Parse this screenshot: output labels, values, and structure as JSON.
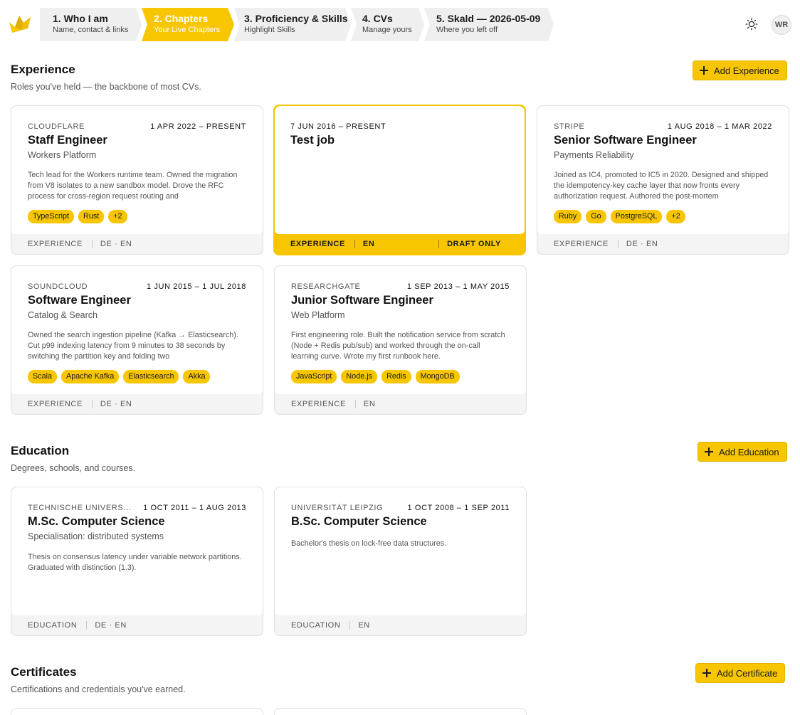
{
  "nav": {
    "steps": [
      {
        "title": "1. Who I am",
        "subtitle": "Name, contact & links"
      },
      {
        "title": "2. Chapters",
        "subtitle": "Your Live Chapters"
      },
      {
        "title": "3. Proficiency & Skills",
        "subtitle": "Highlight Skills"
      },
      {
        "title": "4. CVs",
        "subtitle": "Manage yours"
      },
      {
        "title": "5. Skald — 2026-05-09",
        "subtitle": "Where you left off"
      }
    ],
    "active_step": 1,
    "avatar_initials": "WR",
    "theme_icon": "sun-icon",
    "logo_icon": "bird-logo-icon",
    "accent_color": "#f7c600"
  },
  "experience": {
    "title": "Experience",
    "subtitle": "Roles you've held — the backbone of most CVs.",
    "add_label": "Add Experience",
    "cards": [
      {
        "org": "CLOUDFLARE",
        "dates": "1 APR 2022 – PRESENT",
        "title": "Staff Engineer",
        "subtitle": "Workers Platform",
        "description": "Tech lead for the Workers runtime team. Owned the migration from V8 isolates to a new sandbox model. Drove the RFC process for cross-region request routing and",
        "tags": [
          "TypeScript",
          "Rust",
          "+2"
        ],
        "kind": "EXPERIENCE",
        "langs": "DE · EN"
      },
      {
        "org": "",
        "dates": "7 JUN 2016 – PRESENT",
        "title": "Test job",
        "subtitle": "",
        "description": "",
        "tags": [],
        "kind": "EXPERIENCE",
        "langs": "EN",
        "status": "DRAFT ONLY"
      },
      {
        "org": "STRIPE",
        "dates": "1 AUG 2018 – 1 MAR 2022",
        "title": "Senior Software Engineer",
        "subtitle": "Payments Reliability",
        "description": "Joined as IC4, promoted to IC5 in 2020. Designed and shipped the idempotency-key cache layer that now fronts every authorization request. Authored the post-mortem",
        "tags": [
          "Ruby",
          "Go",
          "PostgreSQL",
          "+2"
        ],
        "kind": "EXPERIENCE",
        "langs": "DE · EN"
      },
      {
        "org": "SOUNDCLOUD",
        "dates": "1 JUN 2015 – 1 JUL 2018",
        "title": "Software Engineer",
        "subtitle": "Catalog & Search",
        "description": "Owned the search ingestion pipeline (Kafka → Elasticsearch). Cut p99 indexing latency from 9 minutes to 38 seconds by switching the partition key and folding two",
        "tags": [
          "Scala",
          "Apache Kafka",
          "Elasticsearch",
          "Akka"
        ],
        "kind": "EXPERIENCE",
        "langs": "DE · EN"
      },
      {
        "org": "RESEARCHGATE",
        "dates": "1 SEP 2013 – 1 MAY 2015",
        "title": "Junior Software Engineer",
        "subtitle": "Web Platform",
        "description": "First engineering role. Built the notification service from scratch (Node + Redis pub/sub) and worked through the on-call learning curve. Wrote my first runbook here.",
        "tags": [
          "JavaScript",
          "Node.js",
          "Redis",
          "MongoDB"
        ],
        "kind": "EXPERIENCE",
        "langs": "EN"
      }
    ]
  },
  "education": {
    "title": "Education",
    "subtitle": "Degrees, schools, and courses.",
    "add_label": "Add Education",
    "cards": [
      {
        "org": "TECHNISCHE UNIVERSIT...",
        "dates": "1 OCT 2011 – 1 AUG 2013",
        "title": "M.Sc. Computer Science",
        "subtitle": "Specialisation: distributed systems",
        "description": "Thesis on consensus latency under variable network partitions. Graduated with distinction (1.3).",
        "kind": "EDUCATION",
        "langs": "DE · EN"
      },
      {
        "org": "UNIVERSITÄT LEIPZIG",
        "dates": "1 OCT 2008 – 1 SEP 2011",
        "title": "B.Sc. Computer Science",
        "subtitle": "",
        "description": "Bachelor's thesis on lock-free data structures.",
        "kind": "EDUCATION",
        "langs": "EN"
      }
    ]
  },
  "certificates": {
    "title": "Certificates",
    "subtitle": "Certifications and credentials you've earned.",
    "add_label": "Add Certificate"
  }
}
